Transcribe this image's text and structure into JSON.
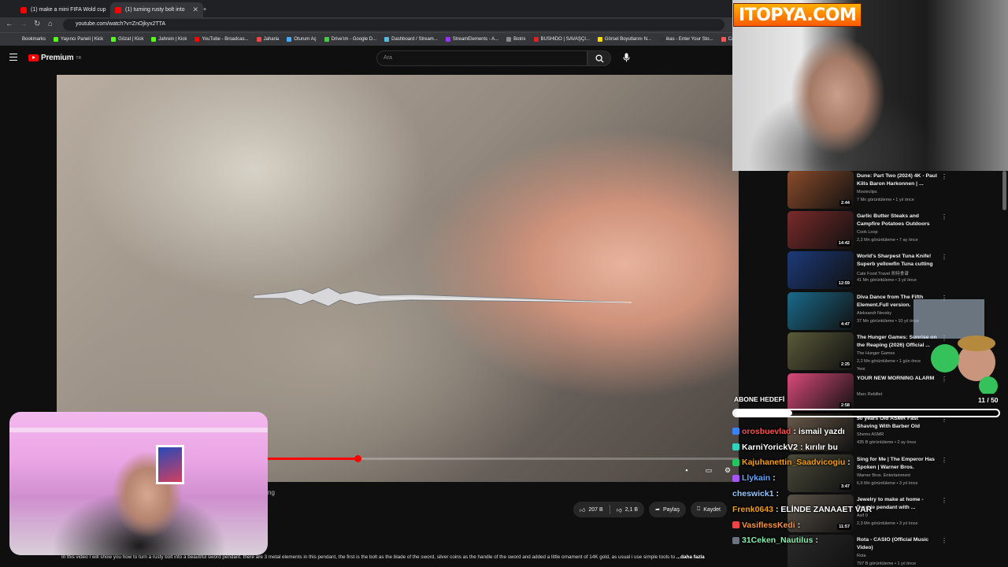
{
  "browser": {
    "tabs": [
      {
        "title": "(1) make a mini FIFA Wold cup",
        "active": false
      },
      {
        "title": "(1) turning rusty bolt into",
        "active": true
      }
    ],
    "url": "youtube.com/watch?v=ZnOjkyx2TTA",
    "bookmarks": [
      "Bookmarks",
      "Yayıncı Paneli | Kick",
      "Gözat | Kick",
      "Jahrein | Kick",
      "YouTube - Broadcas...",
      "Jaharia",
      "Oturum Aç",
      "Drive'ım - Google D...",
      "Dashboard / Stream...",
      "StreamElements - A...",
      "Botrix",
      "BUSHIDO | SAVAŞÇI...",
      "Görsel Boyutlarını N...",
      "ikas - Enter Your Sto...",
      "Ca"
    ]
  },
  "youtube": {
    "logo_text": "Premium",
    "logo_sup": "TR",
    "search_placeholder": "Ara",
    "caption_fragment": "ng",
    "actions": {
      "likes": "207 B",
      "dislikes": "2,1 B",
      "share": "Paylaş",
      "save": "Kaydet"
    },
    "progress": 0.19,
    "description": "In this video I will show you how to turn a rusty bolt into a beautiful sword pendant. there are 3 metal elements in this pendant, the first is the bolt as the blade of the sword, silver coins as the handle of the sword and added a little ornament of 14K gold, as usual i use simple tools to",
    "description_more": "...daha fazla"
  },
  "overlay": {
    "brand_logo": "ITOPYA.COM",
    "goal_label": "ABONE HEDEFİ",
    "goal_count": "11 / 50",
    "goal_fraction": 0.22
  },
  "chat": [
    {
      "user": "orosbuevlad",
      "color": "#ff4d4d",
      "badge": "#3b82f6",
      "text": ": ismail yazdı"
    },
    {
      "user": "KarniYorickV2",
      "color": "#ffffff",
      "badge": "#2dd4bf",
      "text": ": kırılır bu"
    },
    {
      "user": "Kajuhanettin_Saadvicogiu",
      "color": "#f59e0b",
      "badge": "#22c55e",
      "text": ":"
    },
    {
      "user": "Llykain",
      "color": "#60a5fa",
      "badge": "#a855f7",
      "text": ":"
    },
    {
      "user": "cheswick1",
      "color": "#93c5fd",
      "badge": "",
      "text": ":"
    },
    {
      "user": "Frenk0643",
      "color": "#f59e0b",
      "badge": "",
      "text": ": ELİNDE ZANAAET VAR"
    },
    {
      "user": "VasiflessKedi",
      "color": "#fb923c",
      "badge": "#ef4444",
      "text": ":"
    },
    {
      "user": "31Ceken_Nautilus",
      "color": "#86efac",
      "badge": "#6b7280",
      "text": ":"
    }
  ],
  "recommendations": [
    {
      "title": "Dune: Part Two (2024) 4K - Paul Kills Baron Harkonnen | ...",
      "channel": "Movieclips",
      "meta": "7 Mn görüntüleme • 1 yıl önce",
      "duration": "2:44",
      "thumb": "#8a4b2a"
    },
    {
      "title": "Garlic Butter Steaks and Campfire Potatoes Outdoors",
      "channel": "Cook Loop",
      "meta": "2,2 Mn görüntüleme • 7 ay önce",
      "duration": "14:42",
      "thumb": "#7a2a2a"
    },
    {
      "title": "World's Sharpest Tuna Knife! Superb yellowfin Tuna cutting ...",
      "channel": "Cate Food Travel 凯特食谱",
      "meta": "41 Mn görüntüleme • 3 yıl önce",
      "duration": "12:59",
      "thumb": "#1c3a7a"
    },
    {
      "title": "Diva Dance from The Fifth Element.Full version.",
      "channel": "Aleksandr Nevsky",
      "meta": "37 Mn görüntüleme • 10 yıl önce",
      "duration": "4:47",
      "thumb": "#1a6a8a"
    },
    {
      "title": "The Hunger Games: Sunrise on the Reaping (2026) Official ...",
      "channel": "The Hunger Games",
      "meta": "2,2 Mn görüntüleme • 1 gün önce",
      "duration": "2:25",
      "thumb": "#5a5a3a"
    },
    {
      "title": "YOUR NEW MORNING ALARM",
      "channel": "Marc Rebillet",
      "meta": "",
      "duration": "2:58",
      "thumb": "#d94a7a"
    },
    {
      "title": "50 years Old ASMR Fast Shaving With Barber Old [ASM...",
      "channel": "Shems ASMR",
      "meta": "435 B görüntüleme • 2 ay önce",
      "duration": "",
      "thumb": "#6a5a4a"
    },
    {
      "title": "Sing for Me | The Emperor Has Spoken | Warner Bros. Entertainment",
      "channel": "Warner Bros. Entertainment",
      "meta": "6,6 Mn görüntüleme • 3 yıl önce",
      "duration": "3:47",
      "thumb": "#4a4a3a"
    },
    {
      "title": "Jewelry to make at home - Double pendant with ...",
      "channel": "Asif 0",
      "meta": "2,3 Mn görüntüleme • 3 yıl önce",
      "duration": "11:57",
      "thumb": "#5a5248"
    },
    {
      "title": "Rota - CASIO (Official Music Video)",
      "channel": "Rota",
      "meta": "797 B görüntüleme • 1 yıl önce",
      "duration": "",
      "thumb": "#2a2a2a"
    }
  ],
  "badges": {
    "new": "Yeni"
  }
}
